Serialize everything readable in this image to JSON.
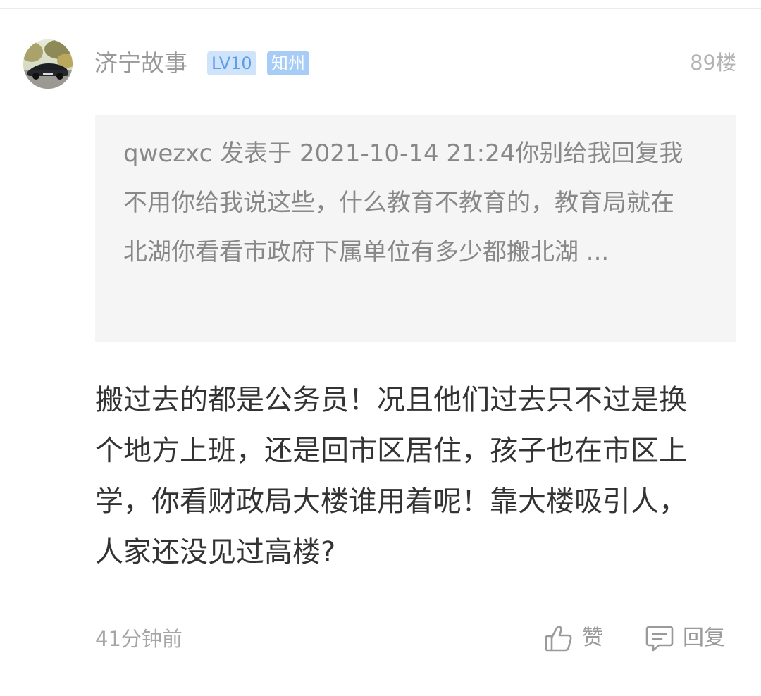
{
  "post": {
    "author": {
      "name": "济宁故事",
      "level_badge": "LV10",
      "title_badge": "知州",
      "avatar_icon": "car-photo-avatar"
    },
    "floor": "89楼",
    "quote": {
      "text": "qwezxc 发表于 2021-10-14 21:24你别给我回复我不用你给我说这些，什么教育不教育的，教育局就在北湖你看看市政府下属单位有多少都搬北湖 ..."
    },
    "body": "搬过去的都是公务员！况且他们过去只不过是换个地方上班，还是回市区居住，孩子也在市区上学，你看财政局大楼谁用着呢！靠大楼吸引人，人家还没见过高楼?",
    "time": "41分钟前",
    "actions": {
      "like_label": "赞",
      "reply_label": "回复"
    }
  },
  "colors": {
    "username": "#999999",
    "level_badge_bg": "#cfe3fb",
    "level_badge_fg": "#5f9de6",
    "title_badge_bg": "#a7cdf6",
    "quote_bg": "#f5f5f5",
    "body_text": "#333333"
  }
}
